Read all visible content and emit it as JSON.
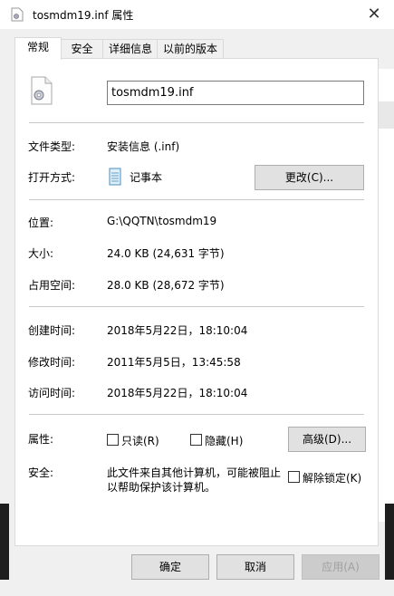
{
  "window": {
    "title": "tosmdm19.inf 属性",
    "close_glyph": "✕"
  },
  "tabs": [
    "常规",
    "安全",
    "详细信息",
    "以前的版本"
  ],
  "active_tab": 0,
  "general": {
    "filename": "tosmdm19.inf",
    "file_type_label": "文件类型:",
    "file_type_value": "安装信息 (.inf)",
    "open_with_label": "打开方式:",
    "open_with_value": "记事本",
    "change_button": "更改(C)...",
    "location_label": "位置:",
    "location_value": "G:\\QQTN\\tosmdm19",
    "size_label": "大小:",
    "size_value": "24.0 KB (24,631 字节)",
    "disk_size_label": "占用空间:",
    "disk_size_value": "28.0 KB (28,672 字节)",
    "created_label": "创建时间:",
    "created_value": "2018年5月22日，18:10:04",
    "modified_label": "修改时间:",
    "modified_value": "2011年5月5日，13:45:58",
    "accessed_label": "访问时间:",
    "accessed_value": "2018年5月22日，18:10:04",
    "attributes_label": "属性:",
    "readonly_label": "只读(R)",
    "hidden_label": "隐藏(H)",
    "advanced_button": "高级(D)...",
    "security_label": "安全:",
    "security_text_1": "此文件来自其他计算机，可能被阻止",
    "security_text_2": "以帮助保护该计算机。",
    "unblock_label": "解除锁定(K)"
  },
  "buttons": {
    "ok": "确定",
    "cancel": "取消",
    "apply": "应用(A)"
  }
}
